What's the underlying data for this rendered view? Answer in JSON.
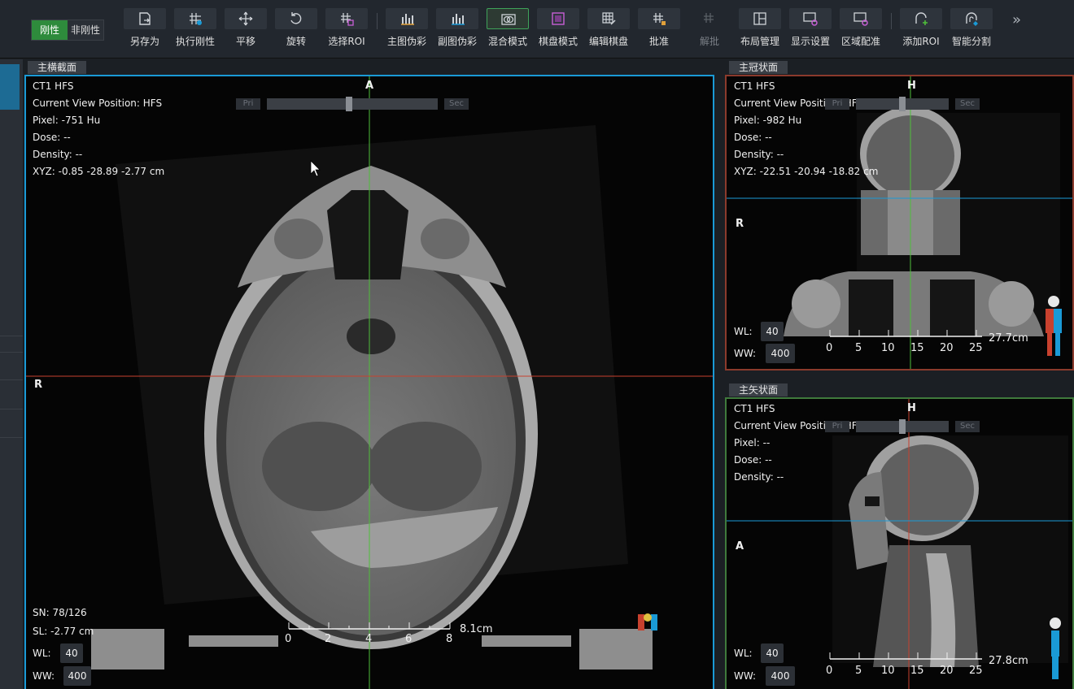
{
  "toolbar": {
    "rigid_label": "刚性",
    "nonrigid_label": "非刚性",
    "tools": [
      {
        "label": "另存为",
        "icon": "save-as-icon"
      },
      {
        "label": "执行刚性",
        "icon": "execute-rigid-icon"
      },
      {
        "label": "平移",
        "icon": "translate-icon"
      },
      {
        "label": "旋转",
        "icon": "rotate-icon"
      },
      {
        "label": "选择ROI",
        "icon": "select-roi-icon"
      },
      {
        "label": "主图伪彩",
        "icon": "primary-pseudocolor-icon"
      },
      {
        "label": "副图伪彩",
        "icon": "secondary-pseudocolor-icon"
      },
      {
        "label": "混合模式",
        "icon": "blend-mode-icon"
      },
      {
        "label": "棋盘模式",
        "icon": "checkerboard-mode-icon"
      },
      {
        "label": "编辑棋盘",
        "icon": "edit-checkerboard-icon"
      },
      {
        "label": "批准",
        "icon": "approve-icon"
      },
      {
        "label": "解批",
        "icon": "unapprove-icon"
      },
      {
        "label": "布局管理",
        "icon": "layout-icon"
      },
      {
        "label": "显示设置",
        "icon": "display-settings-icon"
      },
      {
        "label": "区域配准",
        "icon": "region-registration-icon"
      },
      {
        "label": "添加ROI",
        "icon": "add-roi-icon"
      },
      {
        "label": "智能分割",
        "icon": "smart-segmentation-icon"
      }
    ],
    "more": "»"
  },
  "transverse": {
    "tab": "主横截面",
    "name": "CT1 HFS",
    "view_position": "Current View Position: HFS",
    "pixel": "Pixel: -751 Hu",
    "dose": "Dose: --",
    "density": "Density: --",
    "xyz": "XYZ: -0.85 -28.89 -2.77 cm",
    "top_dir": "A",
    "left_dir": "R",
    "sn": "SN: 78/126",
    "sl": "SL: -2.77 cm",
    "wl_label": "WL:",
    "wl": "40",
    "ww_label": "WW:",
    "ww": "400",
    "pri": "Pri",
    "sec": "Sec",
    "ruler_ticks": [
      "0",
      "2",
      "4",
      "6",
      "8"
    ],
    "ruler_length": "8.1cm",
    "blend_position": 0.48,
    "border_color": "#1a9ad6"
  },
  "coronal": {
    "tab": "主冠状面",
    "name": "CT1 HFS",
    "view_position": "Current View Position: HFS",
    "pixel": "Pixel: -982 Hu",
    "dose": "Dose: --",
    "density": "Density: --",
    "xyz": "XYZ: -22.51 -20.94 -18.82 cm",
    "top_dir": "H",
    "left_dir": "R",
    "wl_label": "WL:",
    "wl": "40",
    "ww_label": "WW:",
    "ww": "400",
    "pri": "Pri",
    "sec": "Sec",
    "ruler_ticks": [
      "0",
      "5",
      "10",
      "15",
      "20",
      "25"
    ],
    "ruler_length": "27.7cm",
    "blend_position": 0.5,
    "border_color": "#8b3a2c"
  },
  "sagittal": {
    "tab": "主矢状面",
    "name": "CT1 HFS",
    "view_position": "Current View Position: HFS",
    "pixel": "Pixel: --",
    "dose": "Dose: --",
    "density": "Density: --",
    "top_dir": "H",
    "left_dir": "A",
    "wl_label": "WL:",
    "wl": "40",
    "ww_label": "WW:",
    "ww": "400",
    "pri": "Pri",
    "sec": "Sec",
    "ruler_ticks": [
      "0",
      "5",
      "10",
      "15",
      "20",
      "25"
    ],
    "ruler_length": "27.8cm",
    "blend_position": 0.5,
    "border_color": "#3f7a3c"
  },
  "colors": {
    "accent_green": "#2e8b3c",
    "crosshair_green": "#4fbf3a",
    "crosshair_red": "#c8412e",
    "crosshair_blue": "#1a9ad6"
  }
}
